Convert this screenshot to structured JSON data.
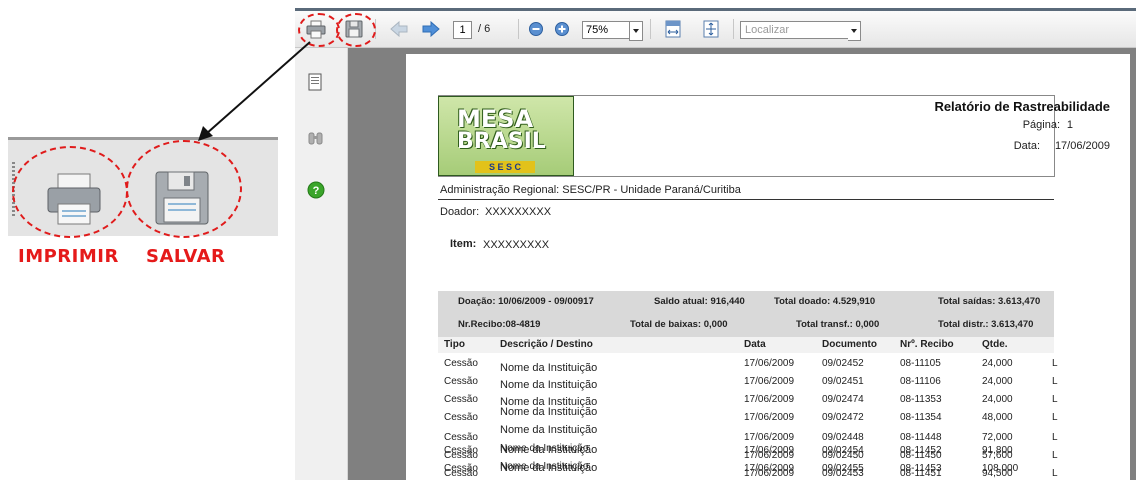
{
  "callout": {
    "print_label": "IMPRIMIR",
    "save_label": "SALVAR"
  },
  "toolbar": {
    "page_current": "1",
    "page_total": "/ 6",
    "zoom": "75%",
    "find_placeholder": "Localizar"
  },
  "report": {
    "title": "Relatório de Rastreabilidade",
    "page_label": "Página:",
    "page_value": "1",
    "date_label": "Data:",
    "date_value": "17/06/2009",
    "logo_line1": "MESA",
    "logo_line2": "BRASIL",
    "logo_sesc": "S E S C",
    "admin": "Administração Regional:  SESC/PR - Unidade Paraná/Curitiba",
    "doador_label": "Doador:",
    "doador_value": "XXXXXXXXX",
    "item_label": "Item:",
    "item_value": "XXXXXXXXX",
    "summary": {
      "doacao": "Doação: 10/06/2009 - 09/00917",
      "saldo": "Saldo atual: 916,440",
      "total_doado": "Total doado: 4.529,910",
      "total_saidas": "Total saídas: 3.613,470",
      "recibo": "Nr.Recibo:08-4819",
      "total_baixas": "Total de baixas: 0,000",
      "total_transf": "Total transf.: 0,000",
      "total_distr": "Total distr.: 3.613,470"
    },
    "columns": {
      "tipo": "Tipo",
      "descricao": "Descrição / Destino",
      "data": "Data",
      "documento": "Documento",
      "recibo": "Nrº. Recibo",
      "qtde": "Qtde."
    },
    "rows": [
      {
        "tipo": "Cessão",
        "nome": "Nome da Instituição",
        "data": "17/06/2009",
        "doc": "09/02452",
        "recibo": "08-11105",
        "qtde": "24,000",
        "flag": "L"
      },
      {
        "tipo": "Cessão",
        "nome": "Nome da Instituição",
        "data": "17/06/2009",
        "doc": "09/02451",
        "recibo": "08-11106",
        "qtde": "24,000",
        "flag": "L"
      },
      {
        "tipo": "Cessão",
        "nome": "Nome da Instituição",
        "data": "17/06/2009",
        "doc": "09/02474",
        "recibo": "08-11353",
        "qtde": "24,000",
        "flag": "L"
      },
      {
        "tipo": "Cessão",
        "nome": "Nome da Instituição",
        "data": "17/06/2009",
        "doc": "09/02472",
        "recibo": "08-11354",
        "qtde": "48,000",
        "flag": "L"
      },
      {
        "tipo": "Cessão",
        "nome": "Nome da Instituição",
        "data": "17/06/2009",
        "doc": "09/02448",
        "recibo": "08-11448",
        "qtde": "72,000",
        "flag": "L"
      },
      {
        "tipo": "Cessão",
        "nome": "Nome da Instituição",
        "data": "17/06/2009",
        "doc": "09/02450",
        "recibo": "08-11450",
        "qtde": "57,600",
        "flag": "L"
      },
      {
        "tipo": "Cessão",
        "nome": "Nome da Instituição",
        "data": "17/06/2009",
        "doc": "09/02453",
        "recibo": "08-11451",
        "qtde": "94,500",
        "flag": "L"
      },
      {
        "tipo": "Cessão",
        "nome": "Nome da Instituição",
        "data": "17/06/2009",
        "doc": "09/02454",
        "recibo": "08-11452",
        "qtde": "91,800",
        "flag": "L"
      },
      {
        "tipo": "Cessão",
        "nome": "Nome da Instituição",
        "data": "17/06/2009",
        "doc": "09/02455",
        "recibo": "08-11453",
        "qtde": "108,000",
        "flag": "L"
      }
    ]
  },
  "colors": {
    "highlight": "#e01b1b",
    "nav_arrow": "#4f8fd8",
    "help": "#3aa52a"
  }
}
